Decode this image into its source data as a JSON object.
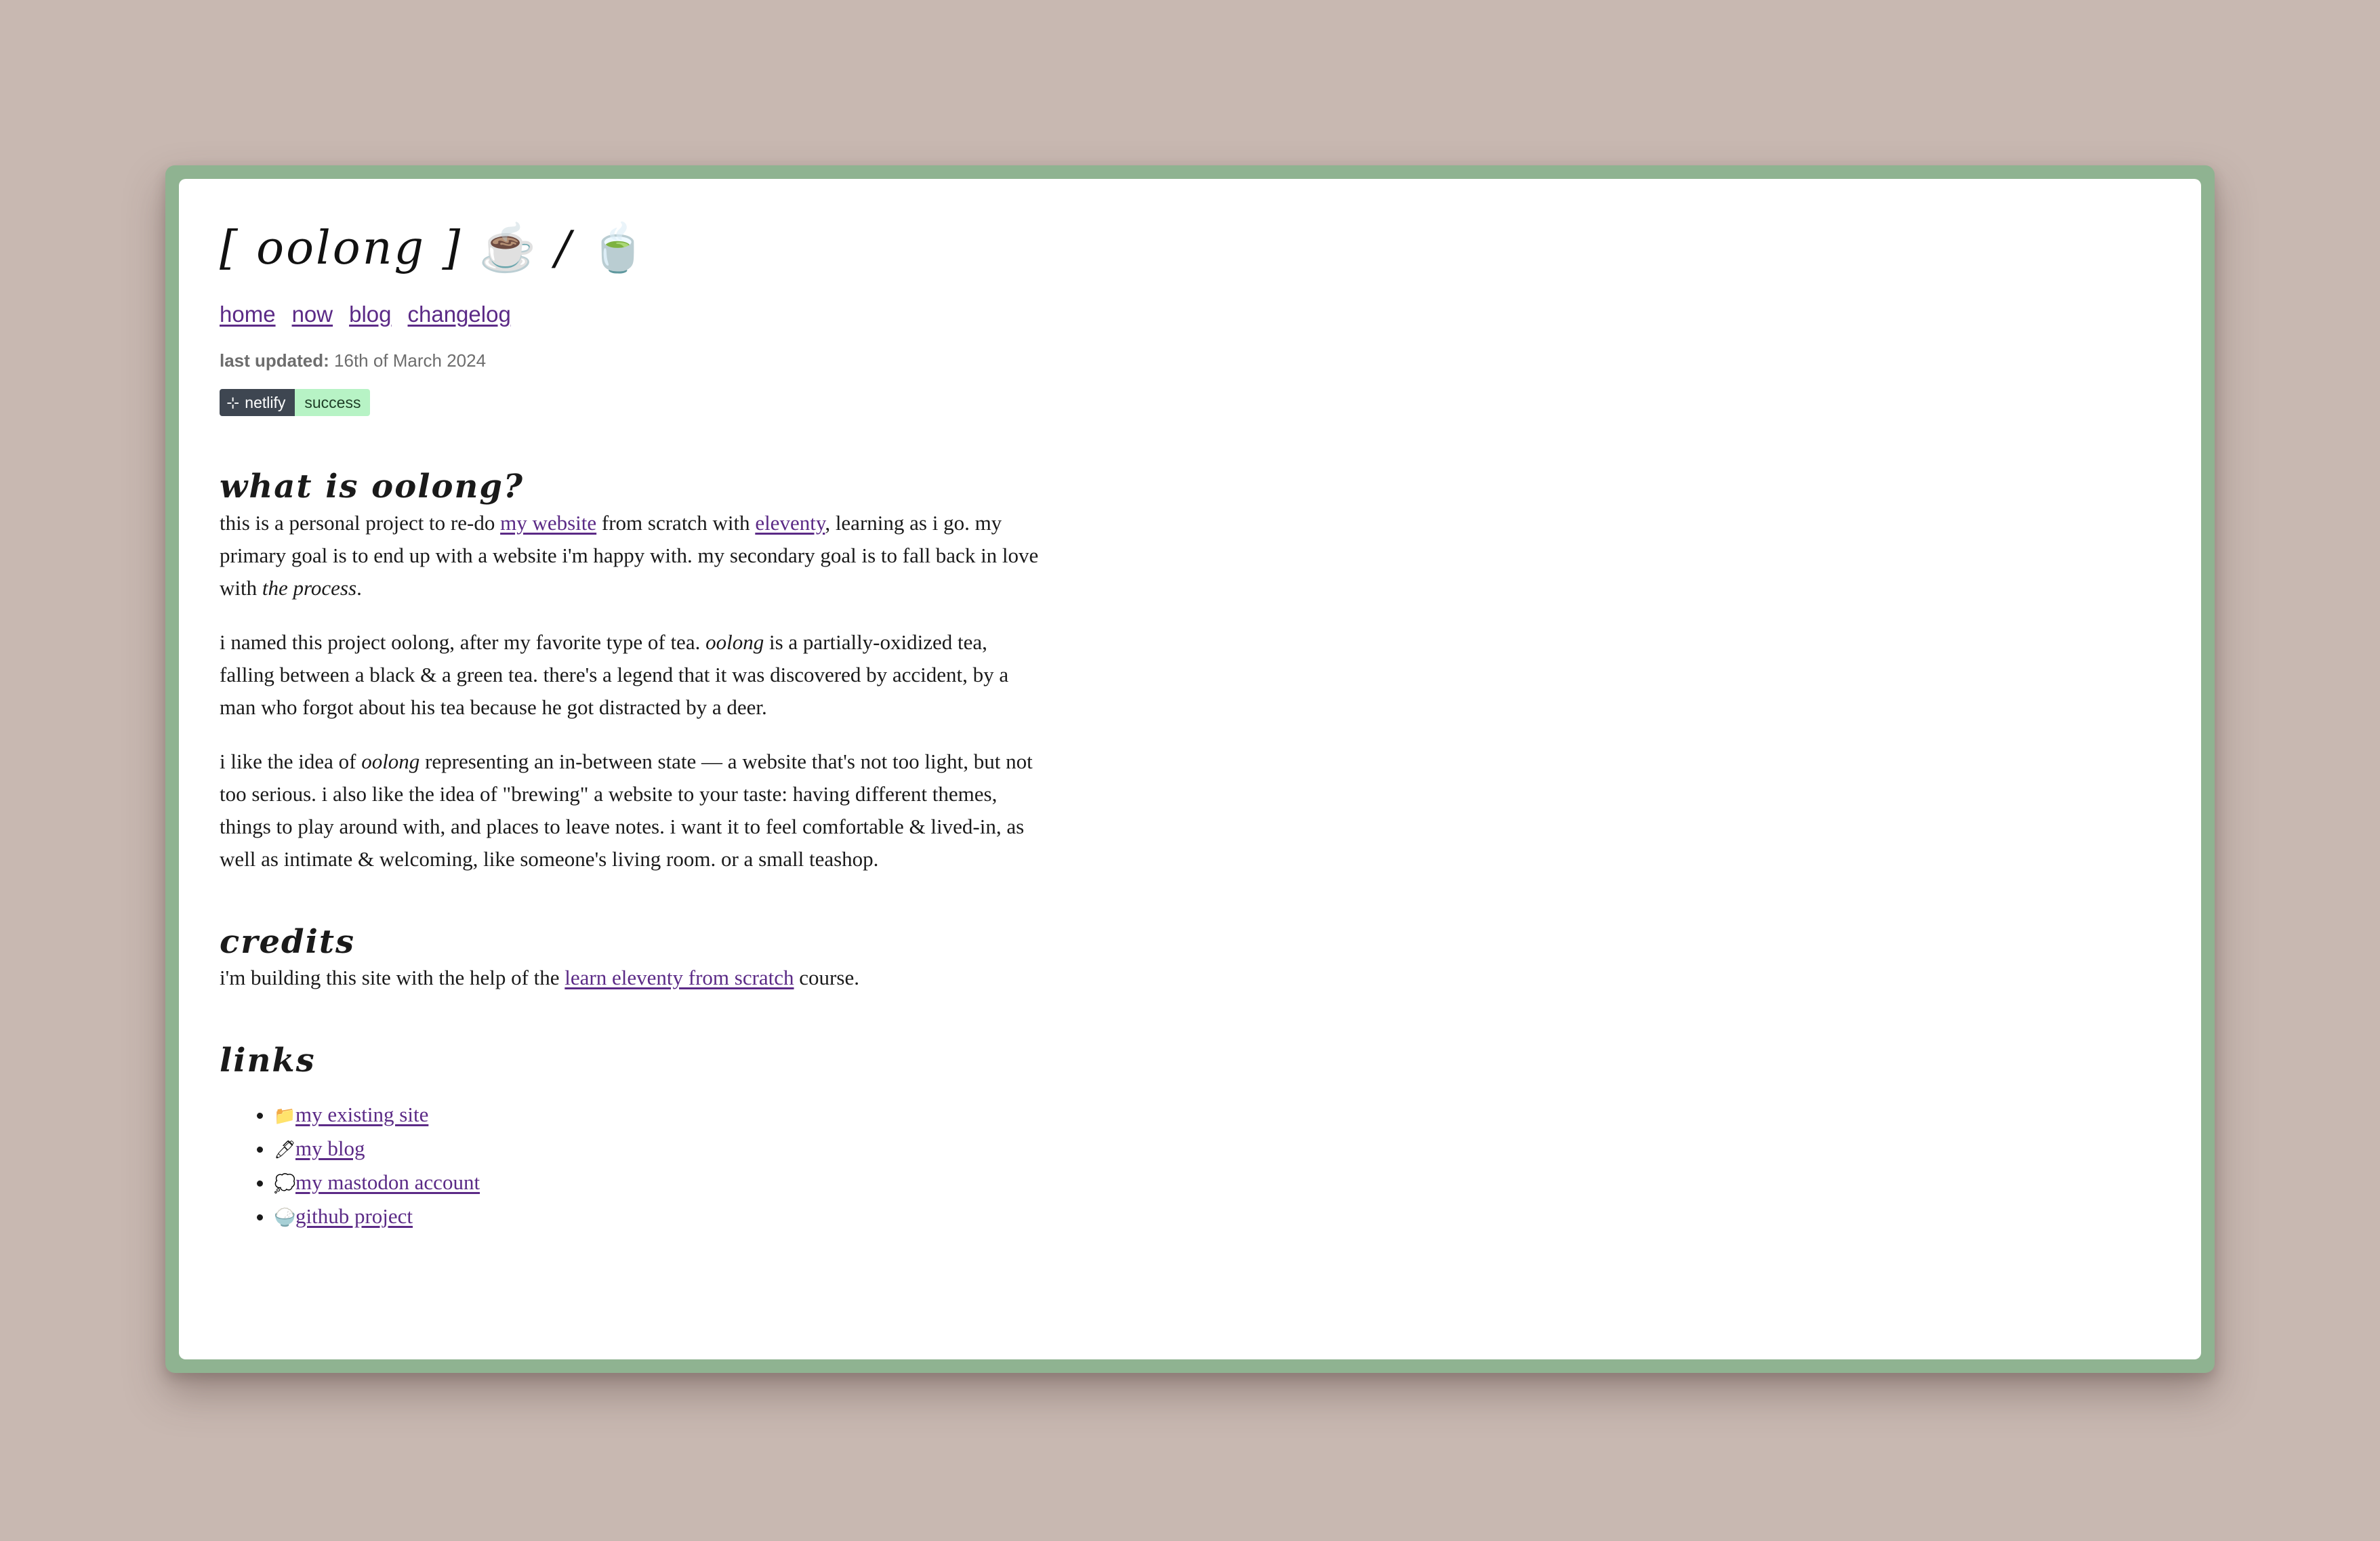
{
  "site": {
    "title_main": "[ oolong ]",
    "title_sep": "/",
    "title_emoji_1": "☕",
    "title_emoji_2": "🍵"
  },
  "nav": {
    "items": [
      {
        "label": "home"
      },
      {
        "label": "now"
      },
      {
        "label": "blog"
      },
      {
        "label": "changelog"
      }
    ]
  },
  "meta": {
    "label": "last updated:",
    "value": "16th of March 2024"
  },
  "badge": {
    "icon": "⊹",
    "left": "netlify",
    "right": "success"
  },
  "about": {
    "heading": "what is oolong?",
    "p1": {
      "a": "this is a personal project to re-do ",
      "link1": "my website",
      "b": " from scratch with ",
      "link2": "eleventy",
      "c": ", learning as i go. my primary goal is to end up with a website i'm happy with. my secondary goal is to fall back in love with ",
      "em": "the process",
      "d": "."
    },
    "p2": {
      "a": "i named this project oolong, after my favorite type of tea. ",
      "em": "oolong",
      "b": " is a partially-oxidized tea, falling between a black & a green tea. there's a legend that it was discovered by accident, by a man who forgot about his tea because he got distracted by a deer."
    },
    "p3": {
      "a": "i like the idea of ",
      "em": "oolong",
      "b": " representing an in-between state — a website that's not too light, but not too serious. i also like the idea of \"brewing\" a website to your taste: having different themes, things to play around with, and places to leave notes. i want it to feel comfortable & lived-in, as well as intimate & welcoming, like someone's living room. or a small teashop."
    }
  },
  "credits": {
    "heading": "credits",
    "a": "i'm building this site with the help of the ",
    "link": "learn eleventy from scratch",
    "b": " course."
  },
  "links": {
    "heading": "links",
    "items": [
      {
        "icon": "📁",
        "label": "my existing site"
      },
      {
        "icon": "🖊",
        "label": "my blog"
      },
      {
        "icon": "💭",
        "label": "my mastodon account"
      },
      {
        "icon": "🍚",
        "label": "github project"
      }
    ]
  },
  "colors": {
    "page_bg": "#c8b8b1",
    "frame": "#8fb391",
    "card": "#ffffff",
    "link": "#5b2a86",
    "badge_dark": "#3e4651",
    "badge_success": "#b7f3c5"
  }
}
